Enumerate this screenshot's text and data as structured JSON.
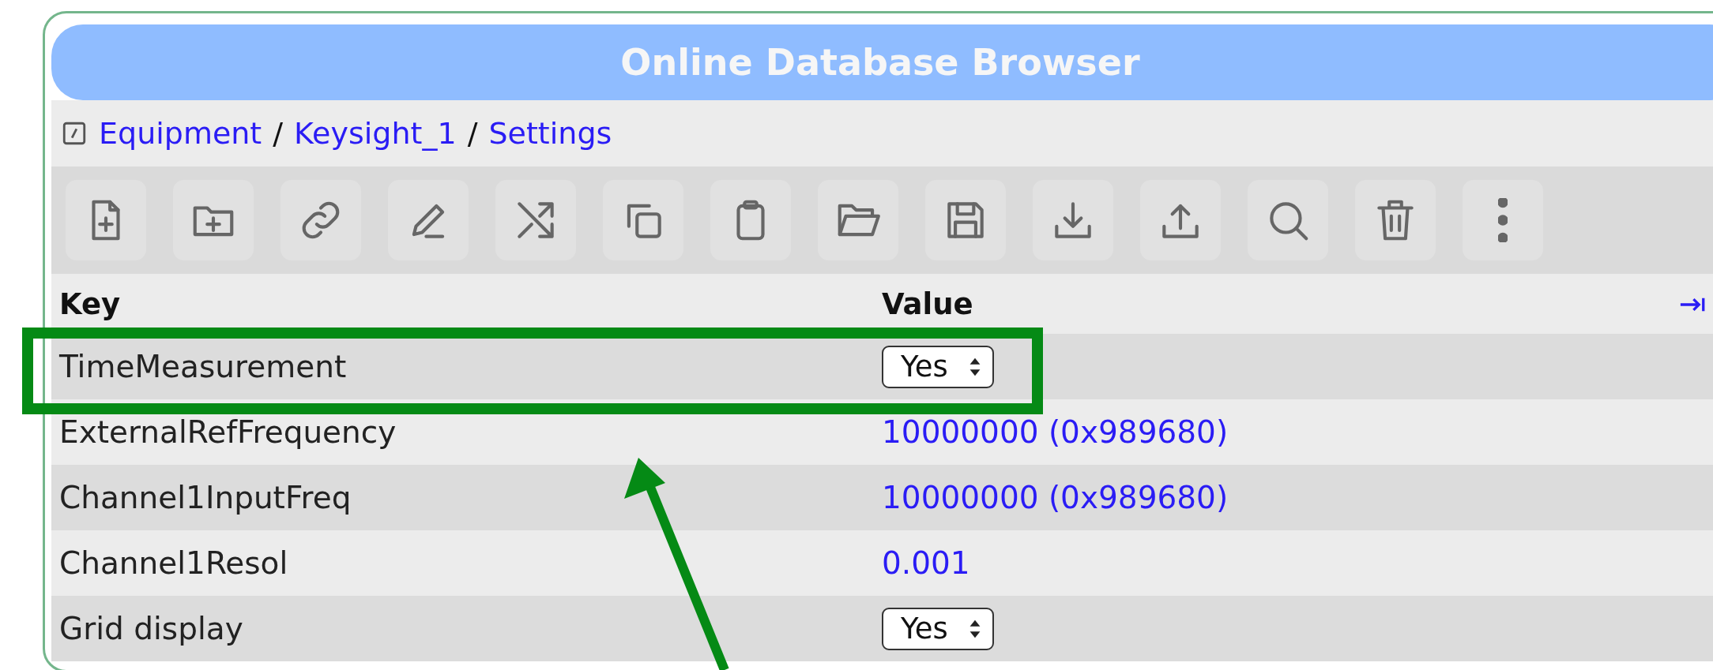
{
  "header": {
    "title": "Online Database Browser"
  },
  "breadcrumb": [
    {
      "kind": "link",
      "label": "Equipment"
    },
    {
      "kind": "separator",
      "label": "/"
    },
    {
      "kind": "link",
      "label": "Keysight_1"
    },
    {
      "kind": "separator",
      "label": "/"
    },
    {
      "kind": "link",
      "label": "Settings"
    }
  ],
  "table": {
    "columns": [
      "Key",
      "Value"
    ],
    "rows": [
      {
        "key": "TimeMeasurement",
        "kind": "select",
        "value": "Yes"
      },
      {
        "key": "ExternalRefFrequency",
        "kind": "text",
        "value": "10000000 (0x989680)"
      },
      {
        "key": "Channel1InputFreq",
        "kind": "text",
        "value": "10000000 (0x989680)"
      },
      {
        "key": "Channel1Resol",
        "kind": "text",
        "value": "0.001"
      },
      {
        "key": "Grid display",
        "kind": "select",
        "value": "Yes"
      }
    ]
  }
}
